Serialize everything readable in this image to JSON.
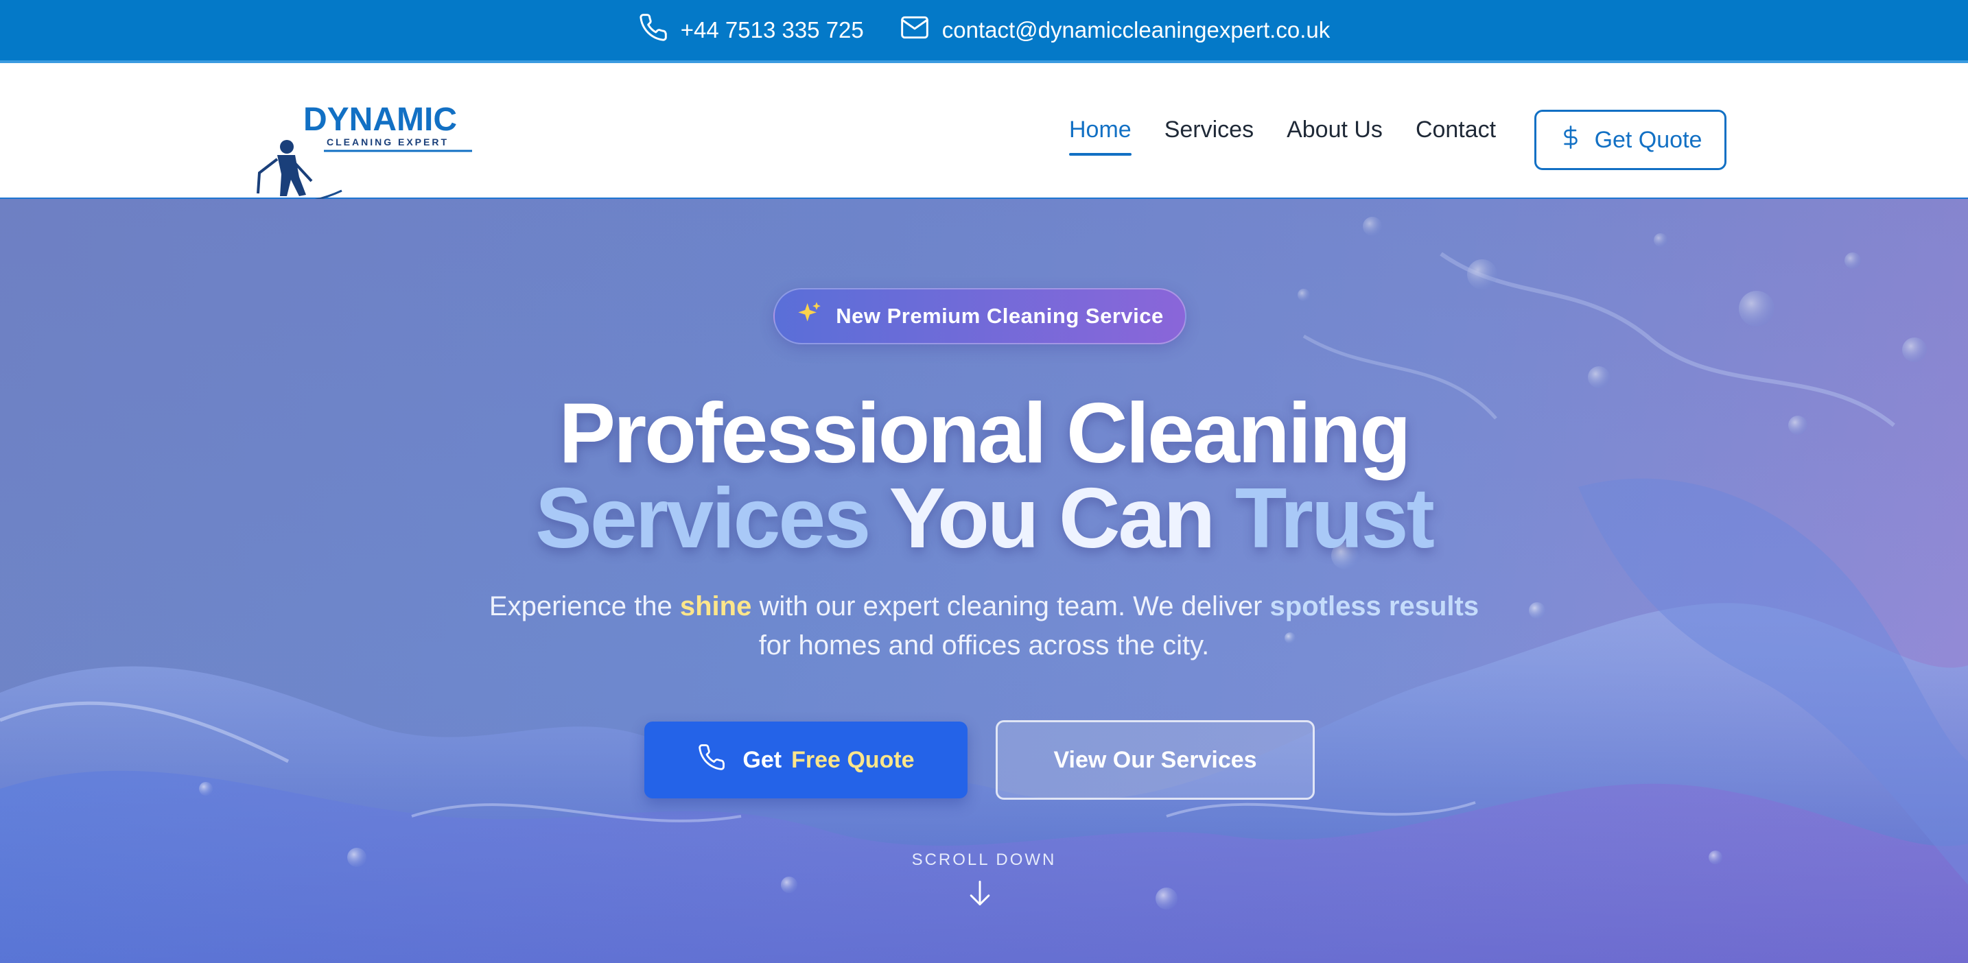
{
  "topbar": {
    "phone": "+44 7513 335 725",
    "email": "contact@dynamiccleaningexpert.co.uk",
    "phone_icon": "phone-icon",
    "email_icon": "mail-icon"
  },
  "header": {
    "logo": {
      "name": "DYNAMIC",
      "tagline": "CLEANING EXPERT"
    },
    "nav": [
      {
        "label": "Home",
        "active": true
      },
      {
        "label": "Services"
      },
      {
        "label": "About Us"
      },
      {
        "label": "Contact"
      }
    ],
    "cta": {
      "label": "Get Quote",
      "icon": "dollar-icon"
    }
  },
  "hero": {
    "badge": {
      "label": "New Premium Cleaning Service",
      "icon": "sparkles-icon"
    },
    "title": {
      "line1": "Professional Cleaning",
      "line2_part1": "Services",
      "line2_part2": "You Can",
      "line2_part3": "Trust"
    },
    "subtitle": {
      "part1": "Experience the ",
      "highlight1": "shine",
      "part2": " with our expert cleaning team. We deliver ",
      "highlight2": "spotless results",
      "part3": "for homes and offices across the city."
    },
    "primary_button": {
      "label": "Get",
      "accent": "Free Quote",
      "icon": "phone-icon"
    },
    "secondary_button": {
      "label": "View Our Services"
    },
    "scroll": {
      "label": "SCROLL DOWN",
      "icon": "arrow-down-icon"
    }
  },
  "colors": {
    "topbar": "#0479c8",
    "accent_blue": "#1270c4",
    "primary_button": "#2463e8",
    "highlight_yellow": "#fde68a",
    "badge_start": "#5a6fd8",
    "badge_end": "#8a66d9"
  }
}
